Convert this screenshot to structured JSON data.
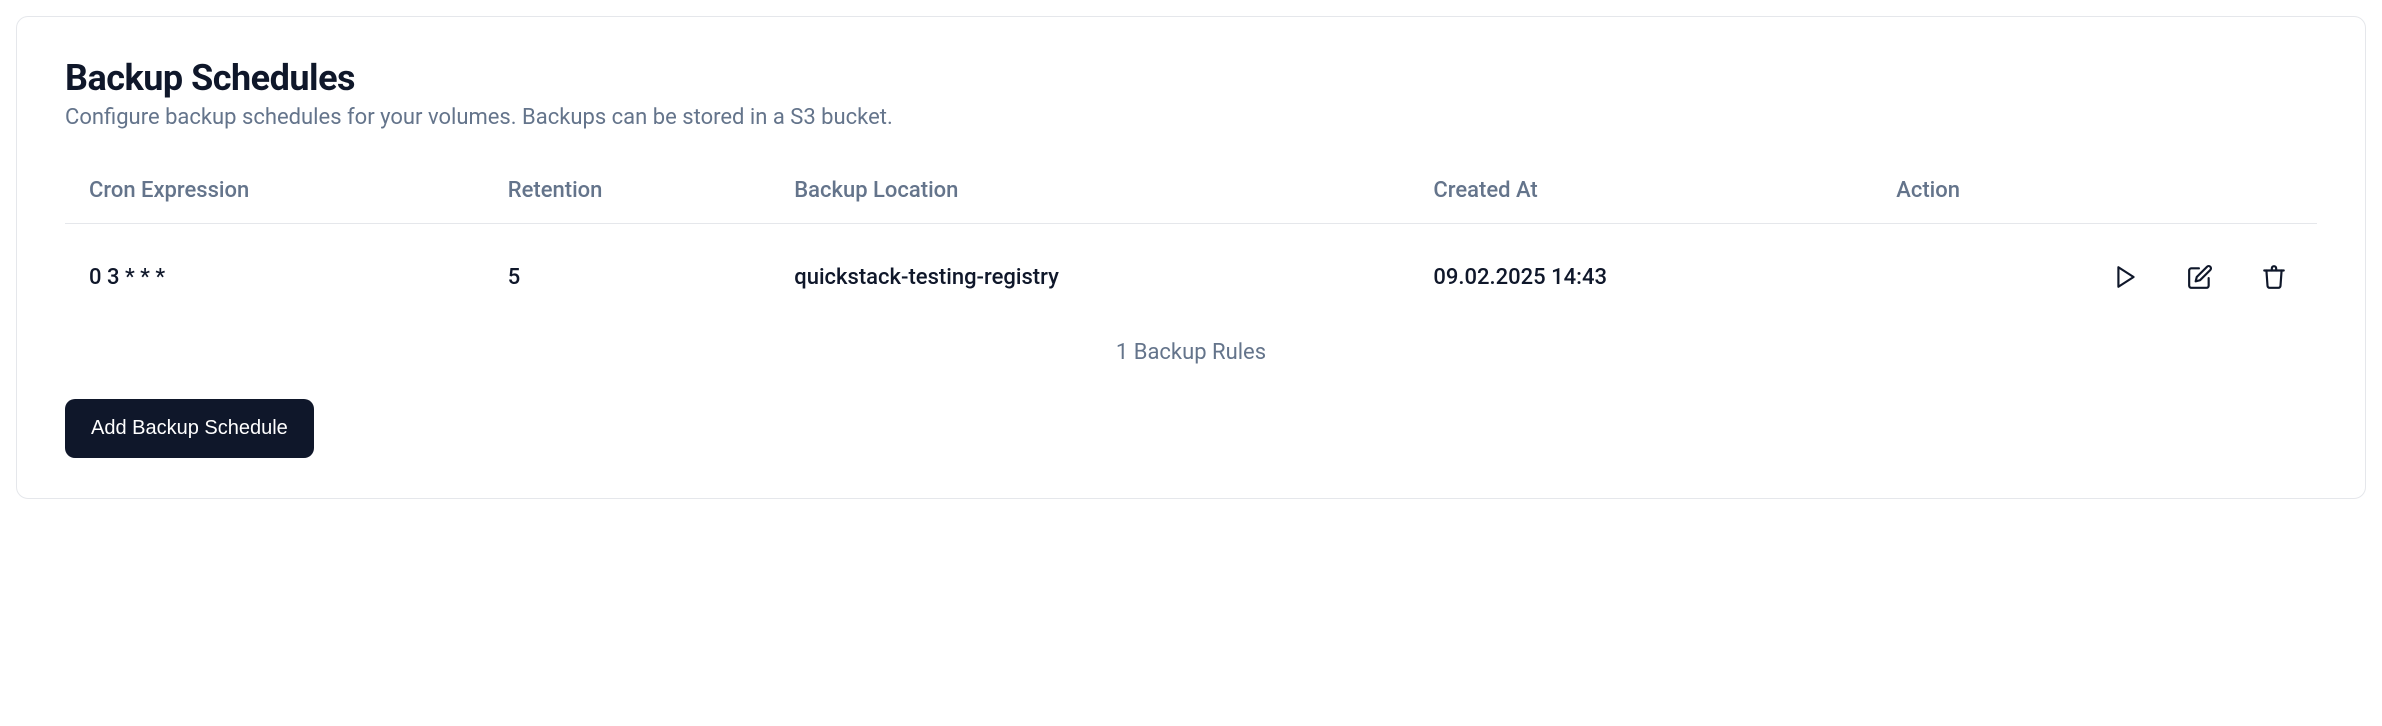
{
  "header": {
    "title": "Backup Schedules",
    "subtitle": "Configure backup schedules for your volumes. Backups can be stored in a S3 bucket."
  },
  "table": {
    "columns": {
      "cron": "Cron Expression",
      "retention": "Retention",
      "location": "Backup Location",
      "created": "Created At",
      "action": "Action"
    },
    "rows": [
      {
        "cron": "0 3 * * *",
        "retention": "5",
        "location": "quickstack-testing-registry",
        "created": "09.02.2025 14:43"
      }
    ],
    "footer": "1 Backup Rules"
  },
  "actions": {
    "add_label": "Add Backup Schedule"
  },
  "icons": {
    "run": "play-icon",
    "edit": "edit-icon",
    "delete": "trash-icon"
  }
}
